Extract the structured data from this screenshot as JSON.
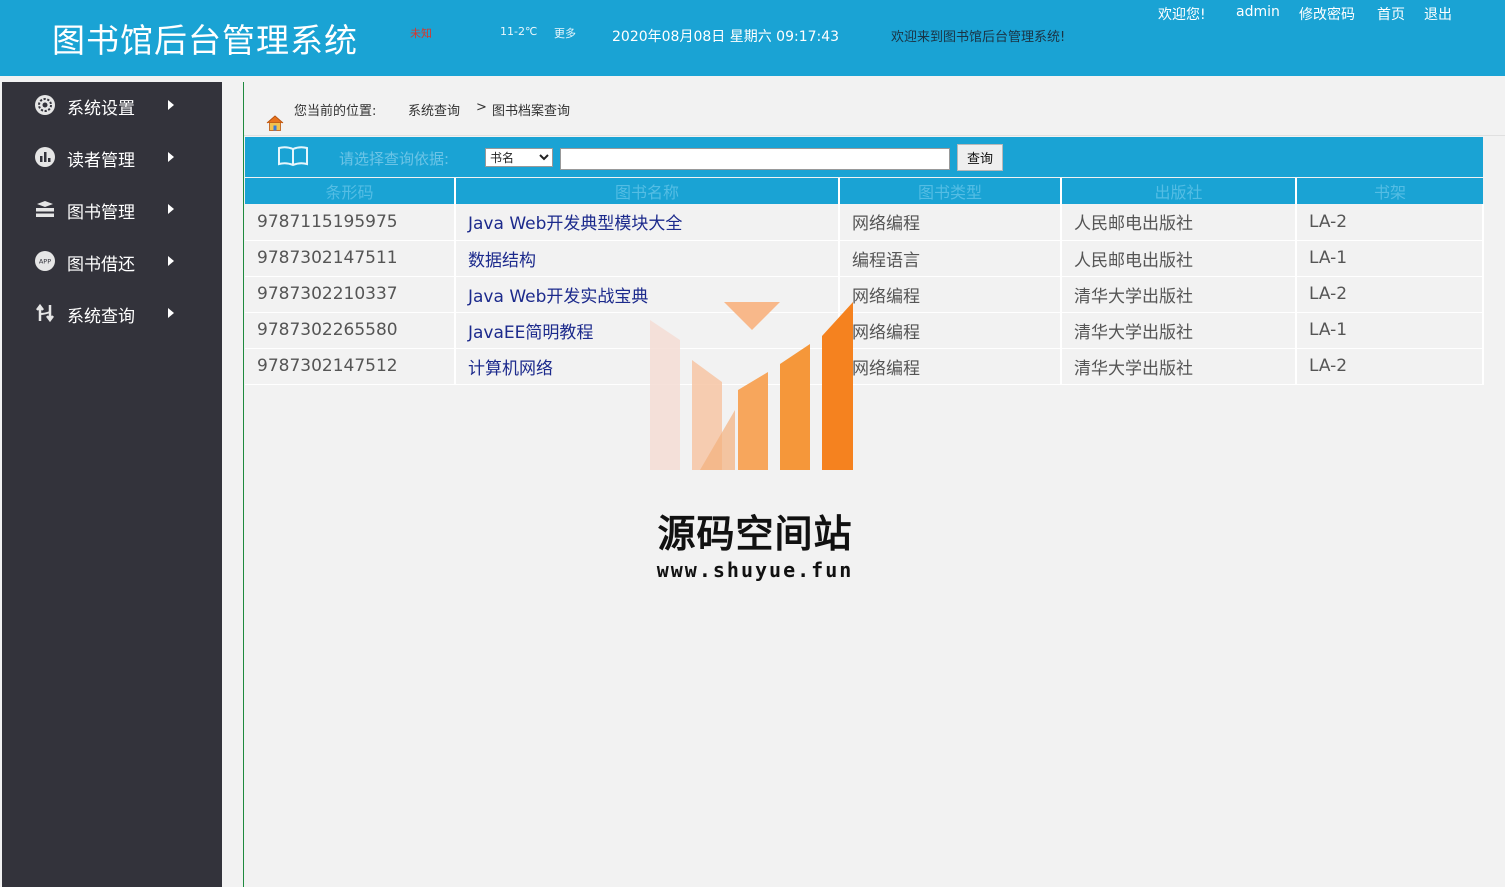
{
  "header": {
    "title": "图书馆后台管理系统",
    "weather_city": "未知",
    "weather_temp": "11-2℃",
    "weather_more": "更多",
    "datetime": "2020年08月08日 星期六 09:17:43",
    "welcome_message": "欢迎来到图书馆后台管理系统!",
    "greeting": "欢迎您!",
    "username": "admin",
    "change_password": "修改密码",
    "home": "首页",
    "logout": "退出"
  },
  "sidebar": {
    "items": [
      {
        "label": "系统设置",
        "icon": "gear-icon"
      },
      {
        "label": "读者管理",
        "icon": "chart-icon"
      },
      {
        "label": "图书管理",
        "icon": "stack-icon"
      },
      {
        "label": "图书借还",
        "icon": "app-icon"
      },
      {
        "label": "系统查询",
        "icon": "exchange-icon"
      }
    ]
  },
  "breadcrumb": {
    "prefix": "您当前的位置:",
    "level1": "系统查询",
    "separator": ">",
    "level2": "图书档案查询"
  },
  "query": {
    "label": "请选择查询依据:",
    "selected": "书名",
    "input_value": "",
    "button": "查询"
  },
  "table": {
    "headers": [
      "条形码",
      "图书名称",
      "图书类型",
      "出版社",
      "书架"
    ],
    "rows": [
      {
        "barcode": "9787115195975",
        "name": "Java Web开发典型模块大全",
        "type": "网络编程",
        "publisher": "人民邮电出版社",
        "shelf": "LA-2"
      },
      {
        "barcode": "9787302147511",
        "name": "数据结构",
        "type": "编程语言",
        "publisher": "人民邮电出版社",
        "shelf": "LA-1"
      },
      {
        "barcode": "9787302210337",
        "name": "Java Web开发实战宝典",
        "type": "网络编程",
        "publisher": "清华大学出版社",
        "shelf": "LA-2"
      },
      {
        "barcode": "9787302265580",
        "name": "JavaEE简明教程",
        "type": "网络编程",
        "publisher": "清华大学出版社",
        "shelf": "LA-1"
      },
      {
        "barcode": "9787302147512",
        "name": "计算机网络",
        "type": "网络编程",
        "publisher": "清华大学出版社",
        "shelf": "LA-2"
      }
    ]
  },
  "watermark": {
    "title": "源码空间站",
    "url": "www.shuyue.fun"
  },
  "colors": {
    "header_bg": "#1aa3d4",
    "sidebar_bg": "#33333b",
    "main_bg": "#f2f2f2",
    "link_color": "#1c2a8c",
    "watermark_orange": "#f5821f"
  }
}
